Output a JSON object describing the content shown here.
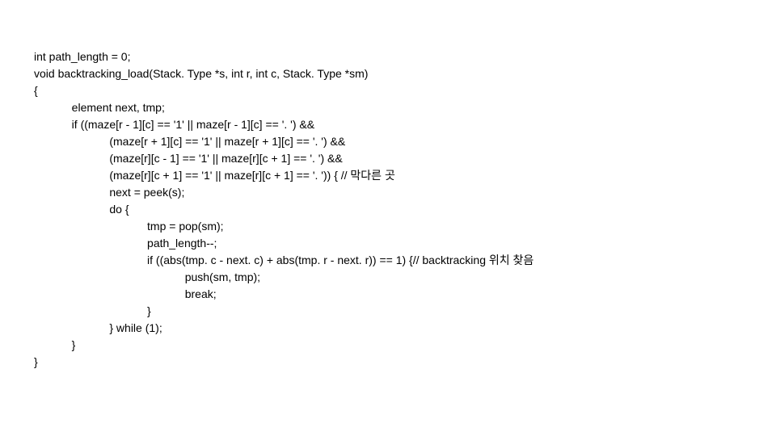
{
  "code": {
    "lines": [
      "int path_length = 0;",
      "void backtracking_load(Stack. Type *s, int r, int c, Stack. Type *sm)",
      "{",
      "            element next, tmp;",
      "",
      "            if ((maze[r - 1][c] == '1' || maze[r - 1][c] == '. ') &&",
      "                        (maze[r + 1][c] == '1' || maze[r + 1][c] == '. ') &&",
      "                        (maze[r][c - 1] == '1' || maze[r][c + 1] == '. ') &&",
      "                        (maze[r][c + 1] == '1' || maze[r][c + 1] == '. ')) { // 막다른 곳",
      "                        next = peek(s);",
      "                        do {",
      "                                    tmp = pop(sm);",
      "                                    path_length--;",
      "                                    if ((abs(tmp. c - next. c) + abs(tmp. r - next. r)) == 1) {// backtracking 위치 찾음",
      "                                                push(sm, tmp);",
      "                                                break;",
      "                                    }",
      "                        } while (1);",
      "            }",
      "}"
    ]
  }
}
